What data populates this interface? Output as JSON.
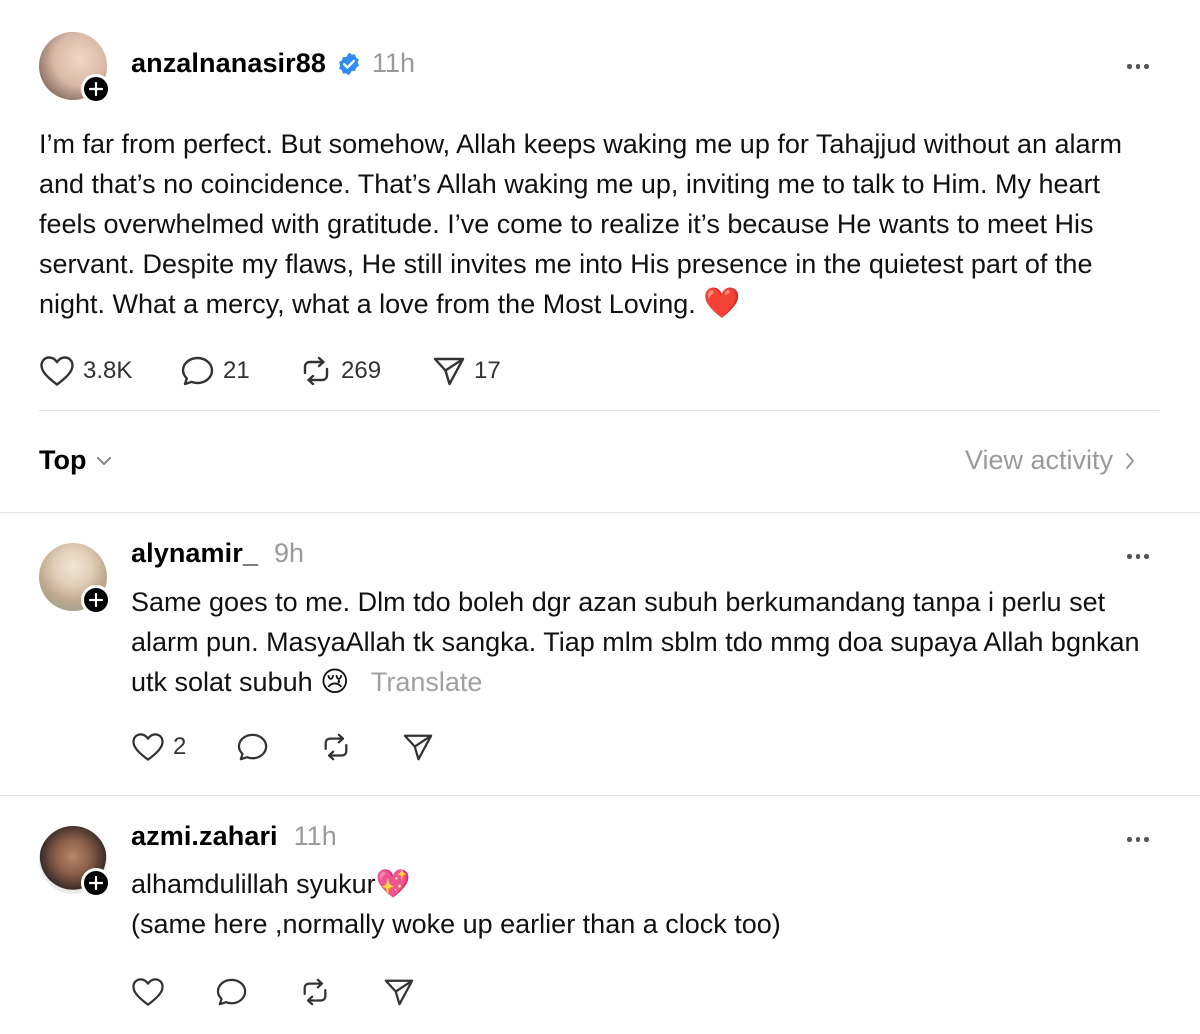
{
  "post": {
    "username": "anzalnanasir88",
    "time": "11h",
    "body": "I’m far from perfect. But somehow, Allah keeps waking me up for Tahajjud without an alarm and that’s no coincidence. That’s Allah waking me up, inviting me to talk to Him. My heart feels overwhelmed with gratitude. I’ve come to realize it’s because He wants to meet His servant. Despite my flaws, He still invites me into His presence in the quietest part of the night. What a mercy, what a love from the Most Loving. ",
    "emoji": "❤️",
    "likes": "3.8K",
    "replies": "21",
    "reposts": "269",
    "shares": "17",
    "icons": [
      "verified-badge-icon",
      "more-icon",
      "heart-icon",
      "comment-icon",
      "repost-icon",
      "share-icon"
    ]
  },
  "sort": {
    "label": "Top",
    "view_activity": "View activity"
  },
  "comments": [
    {
      "username": "alynamir_",
      "time": "9h",
      "body": "Same goes to me. Dlm tdo boleh dgr azan subuh berkumandang tanpa i perlu set alarm pun. MasyaAllah tk sangka. Tiap mlm sblm tdo mmg doa supaya Allah bgnkan utk solat subuh ",
      "emoji": "😢",
      "translate": "Translate",
      "likes": "2"
    },
    {
      "username": "azmi.zahari",
      "time": "11h",
      "line1": "alhamdulillah syukur",
      "emoji": "💖",
      "line2": "(same here ,normally woke up earlier than a clock too)"
    }
  ],
  "colors": {
    "verified": "#2f8cf0",
    "muted": "#9a9a9a",
    "heart": "#e0232a"
  }
}
